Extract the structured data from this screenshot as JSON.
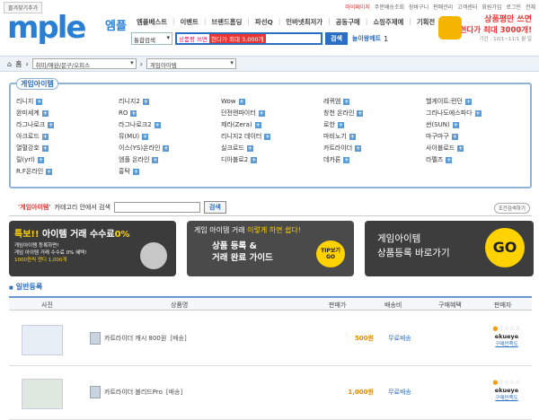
{
  "header": {
    "favorite": "즐겨찾기추가",
    "toplinks": [
      "마이페이지",
      "주문배송조회",
      "장바구니",
      "판매관리",
      "고객센터",
      "회원가입",
      "로그인",
      "전체"
    ],
    "logo": "mple",
    "logo_sub": "엠플",
    "gnb": [
      "엠플베스트",
      "이벤트",
      "브랜드홈딩",
      "파선Q",
      "인바넷최저가",
      "공동구매",
      "쇼핑주제예",
      "기획전"
    ],
    "search": {
      "select": "통합검색",
      "placeholder_pink": "상품평 쓰면",
      "placeholder_red": "현다가 최대 3,000개",
      "button": "검색",
      "today": "놀이왕메트",
      "count": "1"
    },
    "ad": {
      "line1": "상품평만 쓰면",
      "line2": "현다가 최대 3000개!",
      "line3": "기간 : 10/1~11/1 월 일"
    }
  },
  "locbar": {
    "home": "홈",
    "cat1": "취미/애완/문구/오피스",
    "cat2": "게임아이템"
  },
  "category": {
    "title": "게임아이템",
    "items": [
      "리니지",
      "리니지2",
      "Wow",
      "레퀴엠",
      "헬게이트:런던",
      "완미세계",
      "RO",
      "던전앤파이터",
      "창천 온라인",
      "그라나도에스파다",
      "라그나로크",
      "라그나로크2",
      "제라(Zera)",
      "로한",
      "썬(SUN)",
      "아크로드",
      "뮤(MU)",
      "리니지2 데이터",
      "마비노기",
      "마구마구",
      "열혈강호",
      "이스(YS)온라인",
      "실크로드",
      "카트라이더",
      "사이블로드",
      "릴(yrl)",
      "엠플 온라인",
      "디아블로2",
      "데카론",
      "라펠즈",
      "R.F온라인",
      "홍탁"
    ]
  },
  "incat": {
    "label_cat": "'게임아이템'",
    "label_text": "카테고리 안에서 검색",
    "button": "검색",
    "detail": "조건검색하기"
  },
  "banners": {
    "b1": {
      "title_pre": "특보!!",
      "title_mid": " 아이템 거래 수수료",
      "title_end": "0%",
      "l1": "게임아이템 등록하면!",
      "l2": "게임 아이템 거래 수수료 0% 혜택!",
      "l3": "1000원씩 캔디 1,000개"
    },
    "b2": {
      "title_pre": "게임 아이템 거래 ",
      "title_em": "이렇게 하면 쉽다!",
      "l1": "상품 등록 &",
      "l2": "거래 완료 가이드",
      "tip": "TIP보기 GO"
    },
    "b3": {
      "l1": "게임아이템",
      "l2": "상품등록 바로가기",
      "go": "GO"
    }
  },
  "list": {
    "section": "일반등록",
    "headers": [
      "사진",
      "상품명",
      "판매가",
      "배송비",
      "구매혜택",
      "판매자"
    ],
    "rows": [
      {
        "name": "카트라이더 캐시 800원",
        "status": "[배송]",
        "price": "500원",
        "ship": "무료배송",
        "seller": "ekueye",
        "more": "구매만족도"
      },
      {
        "name": "카트라이더 블리드Pro",
        "status": "[배송]",
        "price": "1,000원",
        "ship": "무료배송",
        "seller": "ekueye",
        "more": "구매만족도"
      }
    ]
  }
}
